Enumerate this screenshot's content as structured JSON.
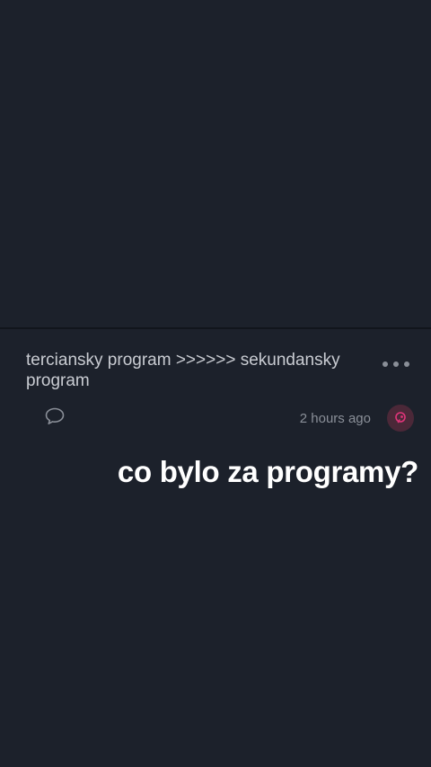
{
  "post": {
    "text": "terciansky program >>>>>> sekundansky program",
    "time": "2 hours ago",
    "more_icon": "ellipsis-icon",
    "comment_icon": "comment-icon",
    "avatar_icon": "avatar-icon"
  },
  "caption": {
    "text": "co bylo za programy?"
  },
  "colors": {
    "background": "#1c212b",
    "text": "#c9ccd2",
    "muted": "#8a8f98",
    "avatar": "#e0357a"
  }
}
